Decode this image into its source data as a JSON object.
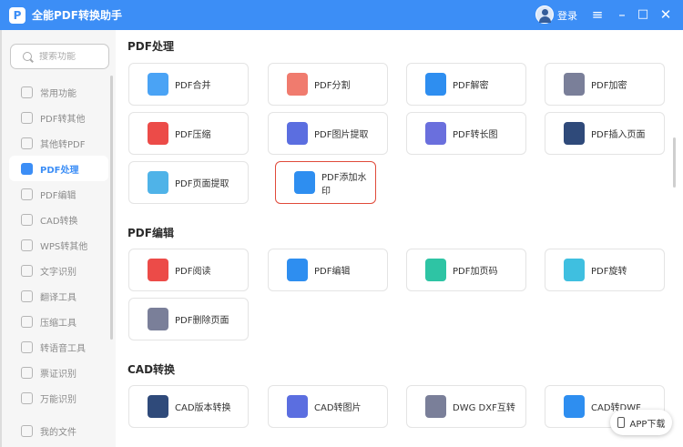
{
  "app": {
    "title": "全能PDF转换助手",
    "logo_text": "P",
    "login_label": "登录"
  },
  "search": {
    "placeholder": "搜索功能"
  },
  "sidebar": {
    "items": [
      {
        "label": "常用功能",
        "active": false
      },
      {
        "label": "PDF转其他",
        "active": false
      },
      {
        "label": "其他转PDF",
        "active": false
      },
      {
        "label": "PDF处理",
        "active": true
      },
      {
        "label": "PDF编辑",
        "active": false
      },
      {
        "label": "CAD转换",
        "active": false
      },
      {
        "label": "WPS转其他",
        "active": false
      },
      {
        "label": "文字识别",
        "active": false
      },
      {
        "label": "翻译工具",
        "active": false
      },
      {
        "label": "压缩工具",
        "active": false
      },
      {
        "label": "转语音工具",
        "active": false
      },
      {
        "label": "票证识别",
        "active": false
      },
      {
        "label": "万能识别",
        "active": false
      }
    ],
    "my_files": "我的文件"
  },
  "sections": {
    "pdf_process": {
      "title": "PDF处理",
      "cards": [
        "PDF合并",
        "PDF分割",
        "PDF解密",
        "PDF加密",
        "PDF压缩",
        "PDF图片提取",
        "PDF转长图",
        "PDF插入页面",
        "PDF页面提取",
        "PDF添加水印"
      ]
    },
    "pdf_edit": {
      "title": "PDF编辑",
      "cards": [
        "PDF阅读",
        "PDF编辑",
        "PDF加页码",
        "PDF旋转",
        "PDF删除页面"
      ]
    },
    "cad": {
      "title": "CAD转换",
      "cards": [
        "CAD版本转换",
        "CAD转图片",
        "DWG DXF互转",
        "CAD转DWF"
      ]
    }
  },
  "app_download": "APP下载",
  "colors": {
    "accent": "#3c8ef6",
    "highlight_border": "#e04a3a"
  }
}
